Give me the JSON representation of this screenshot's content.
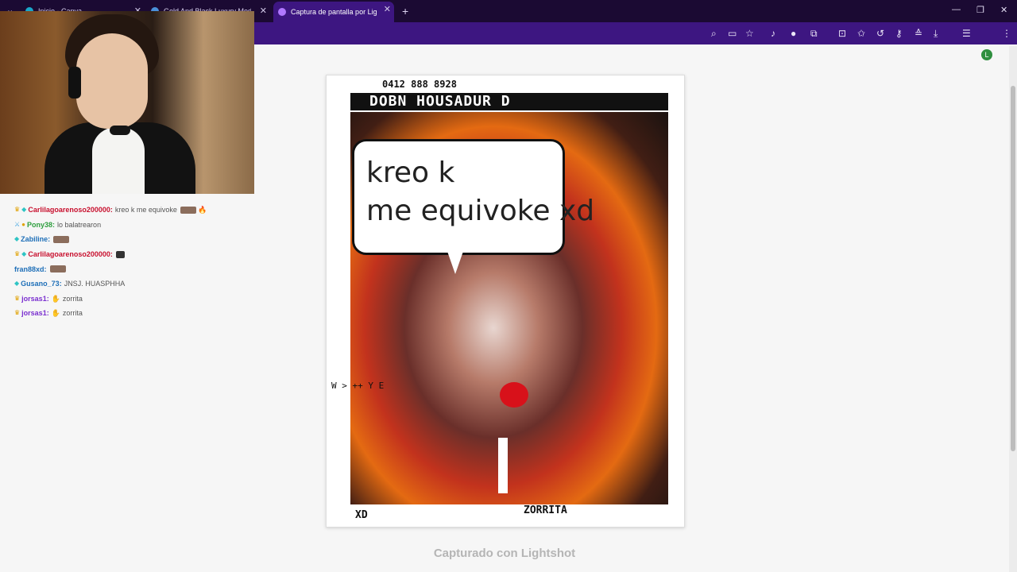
{
  "browser": {
    "tabs": [
      {
        "label": "Inicio - Canva",
        "active": false,
        "favicon_color": "#19a7c9"
      },
      {
        "label": "Gold And Black Luxury Modern",
        "active": false,
        "favicon_color": "#4a90d9"
      },
      {
        "label": "Captura de pantalla por Lightshot",
        "active": true,
        "favicon_color": "#b078ff"
      }
    ],
    "avatar_letter": "L",
    "theme": {
      "tabstrip": "#1b0a33",
      "toolbar": "#3d1681"
    }
  },
  "chat": {
    "messages": [
      {
        "user": "Carlilagoarenoso200000",
        "text": "kreo k me equivoke",
        "color": "#c8102e"
      },
      {
        "user": "Pony38",
        "text": "lo balatrearon",
        "color": "#2e9e3e"
      },
      {
        "user": "Zabiline",
        "text": "",
        "color": "#1e6fb8"
      },
      {
        "user": "Carlilagoarenoso200000",
        "text": "",
        "color": "#c8102e"
      },
      {
        "user": "fran88xd",
        "text": "",
        "color": "#1e6fb8"
      },
      {
        "user": "Gusano_73",
        "text": "JNSJ. HUASPHHA",
        "color": "#1e6fb8"
      },
      {
        "user": "jorsas1",
        "text": "zorrita",
        "color": "#7a2fcf"
      },
      {
        "user": "jorsas1",
        "text": "zorrita",
        "color": "#7a2fcf"
      }
    ]
  },
  "image": {
    "top_number": "0412 888 8928",
    "headline": "DOBN HOUSADUR D",
    "speech_line1": "kreo k",
    "speech_line2": "me equivoke xd",
    "bottom_left": "XD",
    "bottom_label": "ZORRITA",
    "left_letters": "W > ++ Y E"
  },
  "footer": {
    "caption": "Capturado con Lightshot"
  }
}
